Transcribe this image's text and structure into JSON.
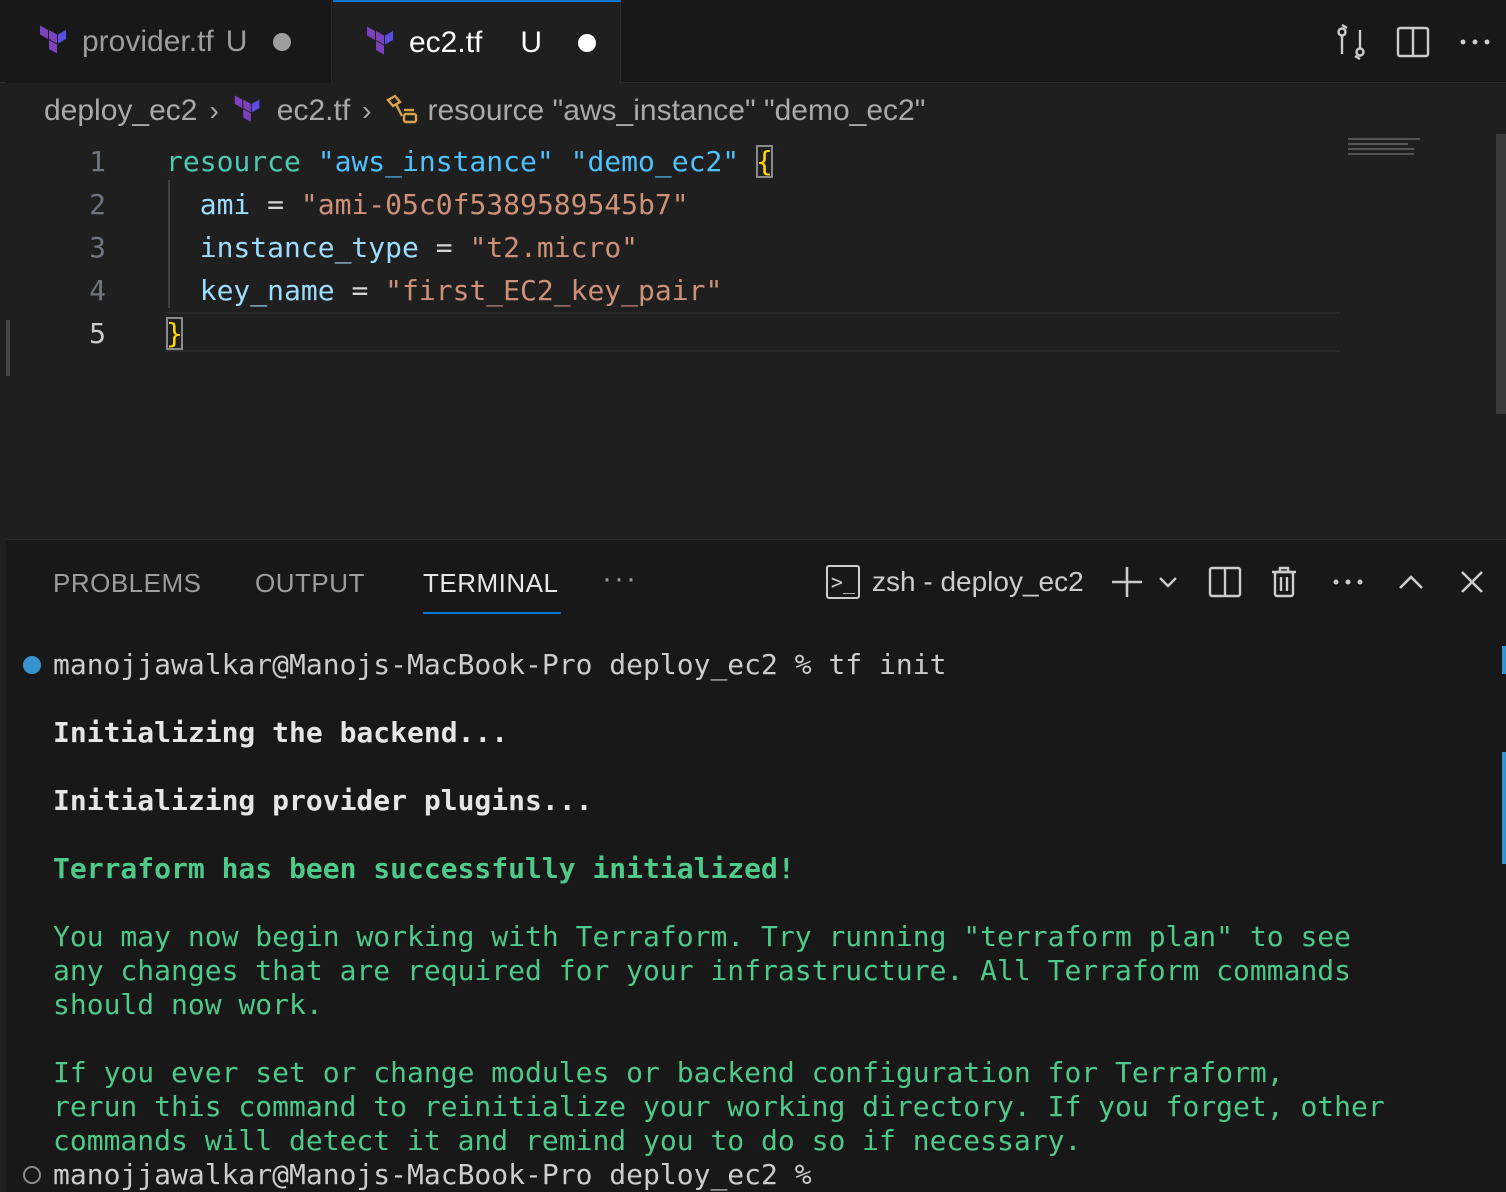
{
  "tabs": [
    {
      "label": "provider.tf",
      "flag": "U",
      "active": false
    },
    {
      "label": "ec2.tf",
      "flag": "U",
      "active": true
    }
  ],
  "tab_actions": [
    "compare-changes-icon",
    "split-editor-icon",
    "more-actions-icon"
  ],
  "breadcrumb": {
    "folder": "deploy_ec2",
    "file": "ec2.tf",
    "symbol": "resource \"aws_instance\" \"demo_ec2\""
  },
  "editor": {
    "current_line": 5,
    "lines": [
      {
        "number": "1",
        "tokens": {
          "keyword": "resource",
          "type_label": "\"aws_instance\"",
          "name_label": "\"demo_ec2\"",
          "brace": "{"
        }
      },
      {
        "number": "2",
        "attr": "ami",
        "op": "=",
        "value": "\"ami-05c0f5389589545b7\""
      },
      {
        "number": "3",
        "attr": "instance_type",
        "op": "=",
        "value": "\"t2.micro\""
      },
      {
        "number": "4",
        "attr": "key_name",
        "op": "=",
        "value": "\"first_EC2_key_pair\""
      },
      {
        "number": "5",
        "brace": "}"
      }
    ]
  },
  "panel": {
    "tabs": [
      "PROBLEMS",
      "OUTPUT",
      "TERMINAL"
    ],
    "active_tab": "TERMINAL",
    "more": "···",
    "terminal_name": "zsh - deploy_ec2",
    "actions": [
      "new-terminal-icon",
      "terminal-dropdown-icon",
      "split-terminal-icon",
      "kill-terminal-icon",
      "more-actions-icon",
      "maximize-panel-icon",
      "close-panel-icon"
    ]
  },
  "terminal": {
    "prompt1": "manojjawalkar@Manojs-MacBook-Pro deploy_ec2 % tf init",
    "backend": "Initializing the backend...",
    "plugins": "Initializing provider plugins...",
    "success": "Terraform has been successfully initialized!",
    "msg1": [
      "You may now begin working with Terraform. Try running \"terraform plan\" to see",
      "any changes that are required for your infrastructure. All Terraform commands",
      "should now work."
    ],
    "msg2": [
      "If you ever set or change modules or backend configuration for Terraform,",
      "rerun this command to reinitialize your working directory. If you forget, other",
      "commands will detect it and remind you to do so if necessary."
    ],
    "prompt2": "manojjawalkar@Manojs-MacBook-Pro deploy_ec2 %"
  },
  "colors": {
    "accent": "#0078d4",
    "terraform_purple": "#7b42bc",
    "success_green": "#4ec98a",
    "status_blue": "#3794cc"
  }
}
